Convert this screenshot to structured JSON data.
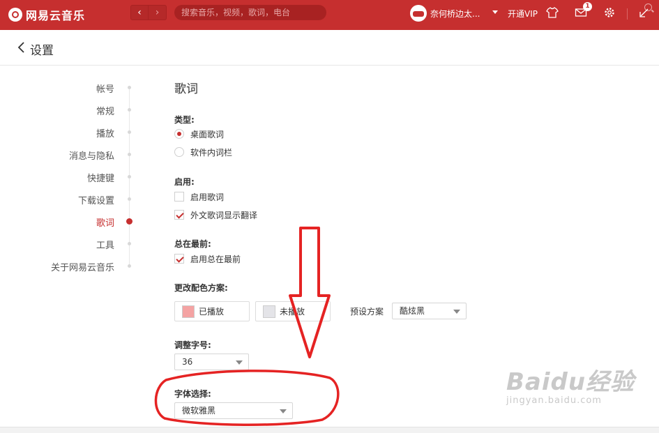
{
  "app": {
    "name": "网易云音乐",
    "search_placeholder": "搜索音乐，视频，歌词，电台",
    "username": "奈何桥边太...",
    "vip_label": "开通VIP",
    "mail_badge": "1"
  },
  "header": {
    "title": "设置"
  },
  "nav": {
    "items": [
      "帐号",
      "常规",
      "播放",
      "消息与隐私",
      "快捷键",
      "下载设置",
      "歌词",
      "工具",
      "关于网易云音乐"
    ],
    "active_index": 6
  },
  "lyrics": {
    "title": "歌词",
    "type_label": "类型:",
    "type_options": [
      "桌面歌词",
      "软件内词栏"
    ],
    "type_selected": 0,
    "enable_label": "启用:",
    "enable_options": [
      {
        "label": "启用歌词",
        "checked": false
      },
      {
        "label": "外文歌词显示翻译",
        "checked": true
      }
    ],
    "top_label": "总在最前:",
    "top_options": [
      {
        "label": "启用总在最前",
        "checked": true
      }
    ],
    "color_label": "更改配色方案:",
    "played_label": "已播放",
    "played_color": "#f4a3a3",
    "unplayed_label": "未播放",
    "unplayed_color": "#e4e4e8",
    "preset_label": "预设方案",
    "preset_value": "酷炫黑",
    "size_label": "调整字号:",
    "size_value": "36",
    "font_label": "字体选择:",
    "font_value": "微软雅黑"
  },
  "colors": {
    "brand": "#c62f2f",
    "annotation": "#e52323"
  },
  "watermark": {
    "main": "Baidu经验",
    "sub": "jingyan.baidu.com"
  }
}
